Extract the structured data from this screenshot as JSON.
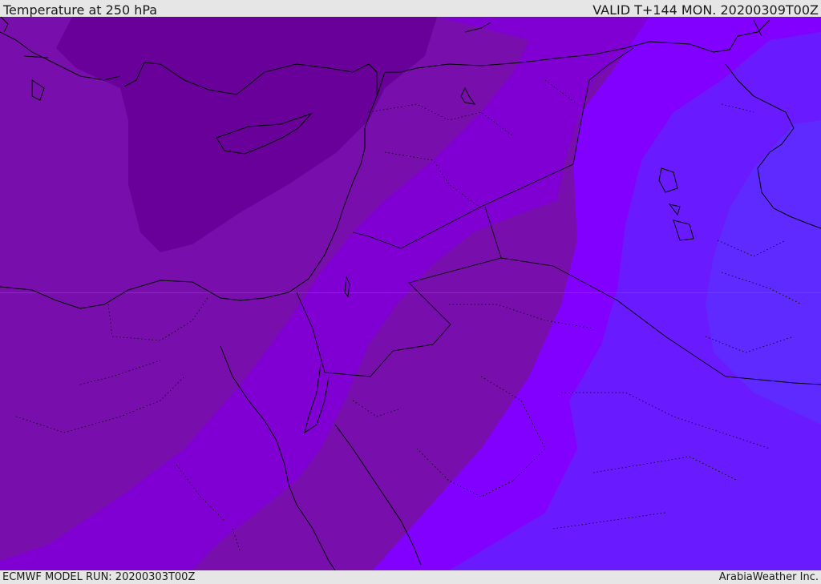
{
  "header": {
    "title": "Temperature at 250 hPa",
    "valid": "VALID T+144 MON. 20200309T00Z"
  },
  "footer": {
    "model_run": "ECMWF MODEL RUN: 20200303T00Z",
    "credit": "ArabiaWeather Inc."
  },
  "map": {
    "fill_colors": [
      "#69009a",
      "#780fac",
      "#8000d4",
      "#8200ff",
      "#6a1aff",
      "#5e2aff",
      "#6f10ff"
    ],
    "coastline_color": "#000000",
    "border_color": "#000000"
  }
}
